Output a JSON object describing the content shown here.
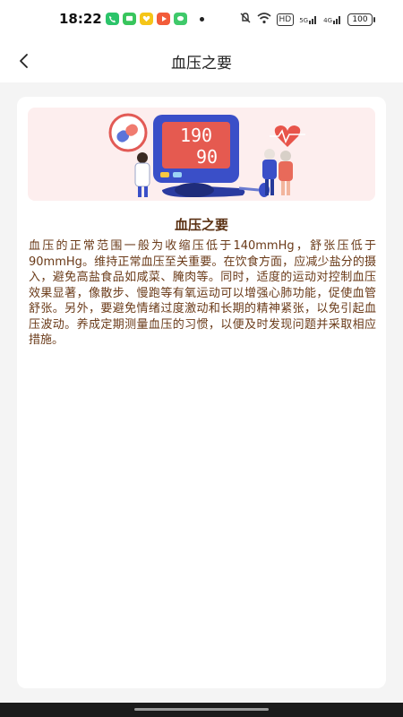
{
  "status_bar": {
    "time": "18:22",
    "battery": "100",
    "hd_badge": "HD",
    "network_1": "5G",
    "network_2": "4G",
    "app_icons": [
      "phone-icon",
      "message-icon",
      "love-icon",
      "video-icon",
      "wechat-icon"
    ],
    "app_icon_colors": [
      "#2bc46a",
      "#38c55c",
      "#f5c518",
      "#f25c3a",
      "#3fc96a"
    ]
  },
  "header": {
    "title": "血压之要",
    "back_icon": "chevron-left-icon"
  },
  "article": {
    "hero_icon": "blood-pressure-monitor-illustration",
    "monitor_reading_top": "190",
    "monitor_reading_bottom": "90",
    "title": "血压之要",
    "body": "血压的正常范围一般为收缩压低于140mmHg，舒张压低于90mmHg。维持正常血压至关重要。在饮食方面，应减少盐分的摄入，避免高盐食品如咸菜、腌肉等。同时，适度的运动对控制血压效果显著，像散步、慢跑等有氧运动可以增强心肺功能，促使血管舒张。另外，要避免情绪过度激动和长期的精神紧张，以免引起血压波动。养成定期测量血压的习惯，以便及时发现问题并采取相应措施。"
  },
  "colors": {
    "title_brown": "#5a3012",
    "body_brown": "#6a3a18",
    "hero_bg": "#fdeeee",
    "monitor_blue": "#3a4fc8",
    "screen_red": "#e55a50"
  }
}
